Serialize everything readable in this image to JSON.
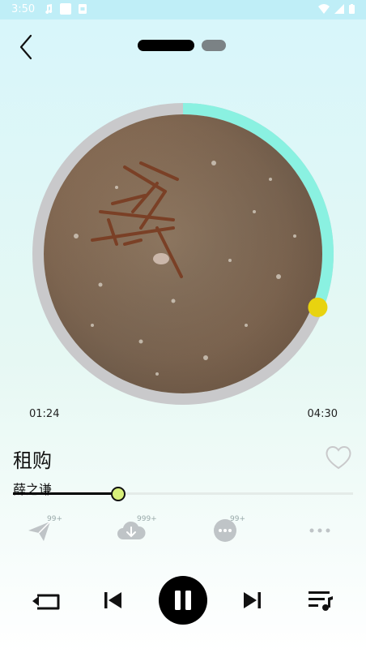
{
  "status_bar": {
    "time": "3:50"
  },
  "player": {
    "time_current": "01:24",
    "time_total": "04:30",
    "progress": 0.31,
    "title": "租购",
    "artist": "薛之谦"
  },
  "actions": [
    {
      "icon": "share-icon",
      "badge": "99+"
    },
    {
      "icon": "download-icon",
      "badge": "999+"
    },
    {
      "icon": "comment-icon",
      "badge": "99+"
    },
    {
      "icon": "more-icon",
      "badge": ""
    }
  ],
  "colors": {
    "accent_ring": "#8af1e1",
    "thumb": "#e8d30f",
    "seek_thumb": "#d8f07a"
  }
}
